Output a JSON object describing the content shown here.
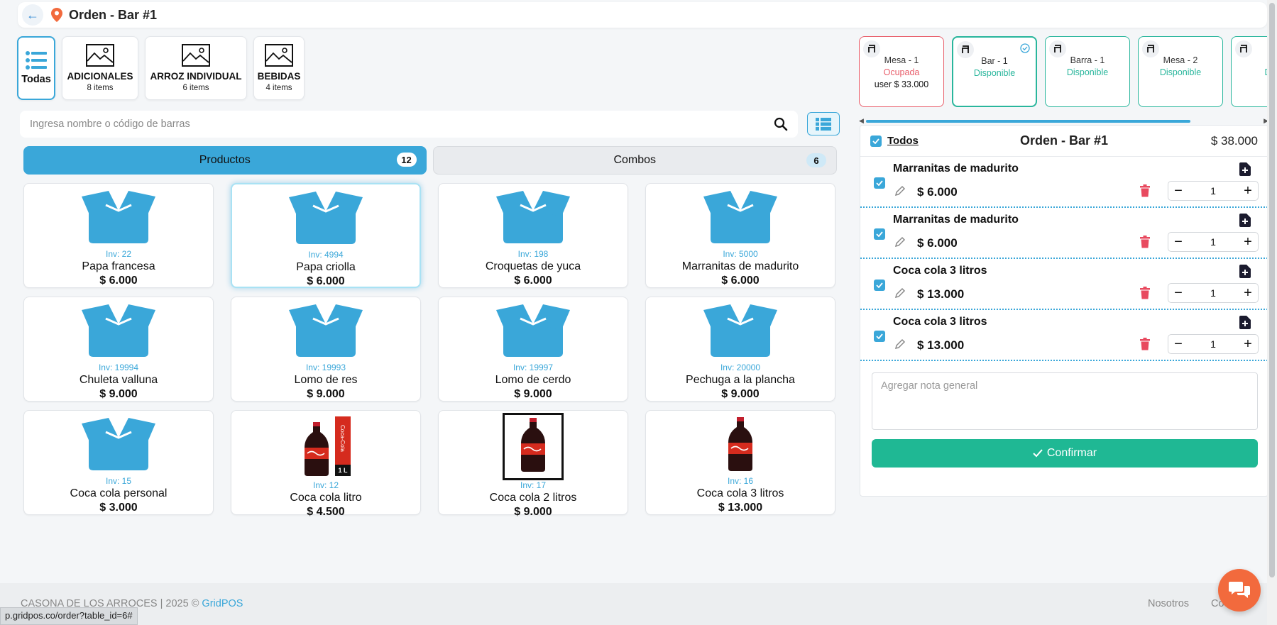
{
  "header": {
    "title": "Orden - Bar #1"
  },
  "categories": [
    {
      "name": "Todas",
      "count": ""
    },
    {
      "name": "ADICIONALES",
      "count": "8 items"
    },
    {
      "name": "ARROZ INDIVIDUAL",
      "count": "6 items"
    },
    {
      "name": "BEBIDAS",
      "count": "4 items"
    }
  ],
  "search": {
    "placeholder": "Ingresa nombre o código de barras"
  },
  "tabs": [
    {
      "label": "Productos",
      "count": "12"
    },
    {
      "label": "Combos",
      "count": "6"
    }
  ],
  "products": [
    {
      "inv": "Inv: 22",
      "name": "Papa francesa",
      "price": "$ 6.000",
      "image": "box-icon"
    },
    {
      "inv": "Inv: 4994",
      "name": "Papa criolla",
      "price": "$ 6.000",
      "image": "box-icon"
    },
    {
      "inv": "Inv: 198",
      "name": "Croquetas de yuca",
      "price": "$ 6.000",
      "image": "box-icon"
    },
    {
      "inv": "Inv: 5000",
      "name": "Marranitas de madurito",
      "price": "$ 6.000",
      "image": "box-icon"
    },
    {
      "inv": "Inv: 19994",
      "name": "Chuleta valluna",
      "price": "$ 9.000",
      "image": "box-icon"
    },
    {
      "inv": "Inv: 19993",
      "name": "Lomo de res",
      "price": "$ 9.000",
      "image": "box-icon"
    },
    {
      "inv": "Inv: 19997",
      "name": "Lomo de cerdo",
      "price": "$ 9.000",
      "image": "box-icon"
    },
    {
      "inv": "Inv: 20000",
      "name": "Pechuga a la plancha",
      "price": "$ 9.000",
      "image": "box-icon"
    },
    {
      "inv": "Inv: 15",
      "name": "Coca cola personal",
      "price": "$ 3.000",
      "image": "box-icon"
    },
    {
      "inv": "Inv: 12",
      "name": "Coca cola litro",
      "price": "$ 4.500",
      "image": "coca-cola-bottle-image",
      "label_brand": "Coca-Cola",
      "label_size": "1 L"
    },
    {
      "inv": "Inv: 17",
      "name": "Coca cola 2 litros",
      "price": "$ 9.000",
      "image": "coca-cola-bottle-image"
    },
    {
      "inv": "Inv: 16",
      "name": "Coca cola 3 litros",
      "price": "$ 13.000",
      "image": "coca-cola-bottle-image"
    }
  ],
  "tables": [
    {
      "name": "Mesa - 1",
      "status": "Ocupada",
      "total": "user $ 33.000"
    },
    {
      "name": "Bar - 1",
      "status": "Disponible",
      "total": ""
    },
    {
      "name": "Barra - 1",
      "status": "Disponible",
      "total": ""
    },
    {
      "name": "Mesa - 2",
      "status": "Disponible",
      "total": ""
    },
    {
      "name": "Ba",
      "status": "Disp",
      "total": ""
    }
  ],
  "order": {
    "select_all": "Todos",
    "title": "Orden - Bar #1",
    "total": "$ 38.000",
    "items": [
      {
        "name": "Marranitas de madurito",
        "price": "$ 6.000",
        "qty": "1"
      },
      {
        "name": "Marranitas de madurito",
        "price": "$ 6.000",
        "qty": "1"
      },
      {
        "name": "Coca cola 3 litros",
        "price": "$ 13.000",
        "qty": "1"
      },
      {
        "name": "Coca cola 3 litros",
        "price": "$ 13.000",
        "qty": "1"
      }
    ],
    "note_placeholder": "Agregar nota general",
    "confirm_label": "Confirmar"
  },
  "footer": {
    "company": "CASONA DE LOS ARROCES | 2025 ©",
    "brand": "GridPOS",
    "links": [
      "Nosotros",
      "Co"
    ]
  },
  "status_url": "p.gridpos.co/order?table_id=6#",
  "colors": {
    "primary": "#3aa7d9",
    "success": "#1fb894",
    "available": "#29b69c",
    "busy": "#e85d6a",
    "delete": "#e84a5f",
    "chat": "#f26a3d"
  }
}
